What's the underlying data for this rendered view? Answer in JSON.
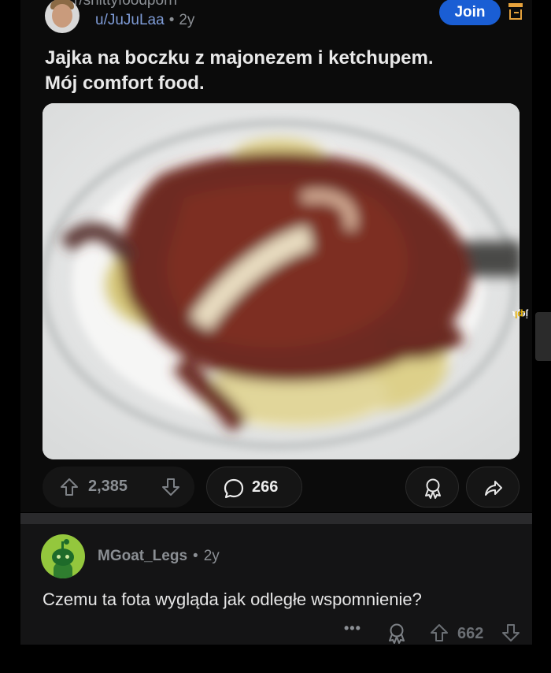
{
  "post": {
    "subreddit": "r/shittyfoodporn",
    "author": "u/JuJuLaa",
    "separator": "•",
    "age": "2y",
    "join_label": "Join",
    "title_line1": "Jajka na boczku z majonezem i ketchupem.",
    "title_line2": "Mój comfort food.",
    "upvotes": "2,385",
    "comments": "266"
  },
  "comment": {
    "author": "MGoat_Legs",
    "separator": "•",
    "age": "2y",
    "text": "Czemu ta fota wygląda jak odległe wspomnienie?",
    "more": "•••",
    "score": "662"
  },
  "watermark": {
    "text": "jeja",
    "accent": ".pl"
  },
  "colors": {
    "background": "#000000",
    "card": "#0b0b0b",
    "join_button": "#1a5ed4",
    "username_link": "#7e9bd6",
    "muted_text": "#8b8f94"
  }
}
